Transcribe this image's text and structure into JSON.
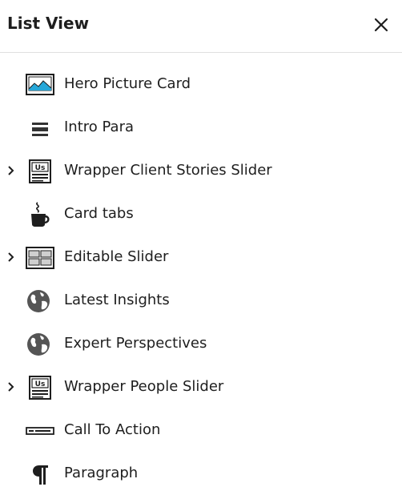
{
  "panel": {
    "title": "List View",
    "close_label": "close"
  },
  "items": [
    {
      "label": "Hero Picture Card",
      "icon": "image-icon",
      "expandable": false
    },
    {
      "label": "Intro Para",
      "icon": "text-block-icon",
      "expandable": false
    },
    {
      "label": "Wrapper Client Stories Slider",
      "icon": "wrapper-block-icon",
      "expandable": true
    },
    {
      "label": "Card tabs",
      "icon": "coffee-cup-icon",
      "expandable": false
    },
    {
      "label": "Editable Slider",
      "icon": "slider-grid-icon",
      "expandable": true
    },
    {
      "label": "Latest Insights",
      "icon": "globe-icon",
      "expandable": false
    },
    {
      "label": "Expert Perspectives",
      "icon": "globe-icon",
      "expandable": false
    },
    {
      "label": "Wrapper People Slider",
      "icon": "wrapper-block-icon",
      "expandable": true
    },
    {
      "label": "Call To Action",
      "icon": "button-bar-icon",
      "expandable": false
    },
    {
      "label": "Paragraph",
      "icon": "pilcrow-icon",
      "expandable": false
    }
  ]
}
